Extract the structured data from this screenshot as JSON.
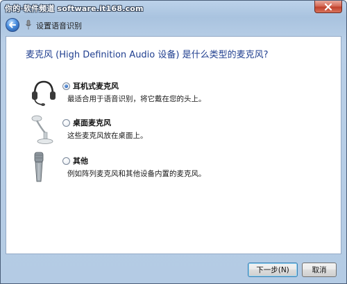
{
  "watermark": "你的·软件频道 software.it168.com",
  "nav": {
    "title": "设置语音识别"
  },
  "heading": "麦克风 (High Definition Audio 设备) 是什么类型的麦克风?",
  "options": [
    {
      "label": "耳机式麦克风",
      "description": "最适合用于语音识别，将它戴在您的头上。",
      "icon": "headset-microphone-icon",
      "checked": true
    },
    {
      "label": "桌面麦克风",
      "description": "这些麦克风放在桌面上。",
      "icon": "desktop-microphone-icon",
      "checked": false
    },
    {
      "label": "其他",
      "description": "例如阵列麦克风和其他设备内置的麦克风。",
      "icon": "handheld-microphone-icon",
      "checked": false
    }
  ],
  "buttons": {
    "next": "下一步(N)",
    "cancel": "取消"
  },
  "colors": {
    "heading": "#1f3e8f",
    "close_button": "#c1412c",
    "window_chrome": "#b4cbe4"
  }
}
